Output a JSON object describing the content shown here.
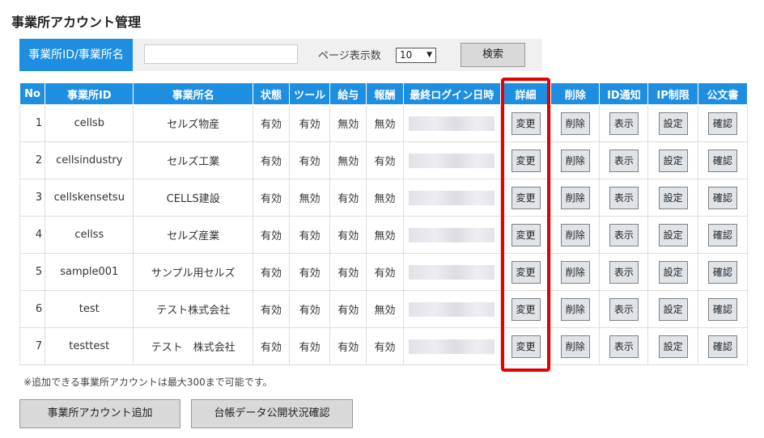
{
  "page": {
    "title": "事業所アカウント管理"
  },
  "search": {
    "label": "事業所ID/事業所名",
    "value": "",
    "page_size_label": "ページ表示数",
    "page_size": "10",
    "button": "検索"
  },
  "table": {
    "headers": {
      "no": "No",
      "id": "事業所ID",
      "name": "事業所名",
      "status": "状態",
      "tool": "ツール",
      "salary": "給与",
      "reward": "報酬",
      "last_login": "最終ログイン日時",
      "detail": "詳細",
      "delete": "削除",
      "id_notice": "ID通知",
      "ip": "IP制限",
      "doc": "公文書"
    },
    "button_labels": {
      "detail": "変更",
      "delete": "削除",
      "id_notice": "表示",
      "ip": "設定",
      "doc": "確認"
    },
    "rows": [
      {
        "no": "1",
        "id": "cellsb",
        "name": "セルズ物産",
        "status": "有効",
        "tool": "有効",
        "salary": "無効",
        "reward": "無効"
      },
      {
        "no": "2",
        "id": "cellsindustry",
        "name": "セルズ工業",
        "status": "有効",
        "tool": "有効",
        "salary": "無効",
        "reward": "有効"
      },
      {
        "no": "3",
        "id": "cellskensetsu",
        "name": "CELLS建設",
        "status": "有効",
        "tool": "無効",
        "salary": "有効",
        "reward": "無効"
      },
      {
        "no": "4",
        "id": "cellss",
        "name": "セルズ産業",
        "status": "有効",
        "tool": "有効",
        "salary": "有効",
        "reward": "無効"
      },
      {
        "no": "5",
        "id": "sample001",
        "name": "サンプル用セルズ",
        "status": "有効",
        "tool": "有効",
        "salary": "有効",
        "reward": "有効"
      },
      {
        "no": "6",
        "id": "test",
        "name": "テスト株式会社",
        "status": "有効",
        "tool": "有効",
        "salary": "有効",
        "reward": "無効"
      },
      {
        "no": "7",
        "id": "testtest",
        "name": "テスト　株式会社",
        "status": "有効",
        "tool": "有効",
        "salary": "有効",
        "reward": "有効"
      }
    ]
  },
  "footer": {
    "note": "※追加できる事業所アカウントは最大300まで可能です。",
    "add_button": "事業所アカウント追加",
    "ledger_button": "台帳データ公開状況確認"
  },
  "colors": {
    "header_blue": "#1e8fe0",
    "highlight_red": "#e40000",
    "button_gray": "#dfe4e8"
  }
}
